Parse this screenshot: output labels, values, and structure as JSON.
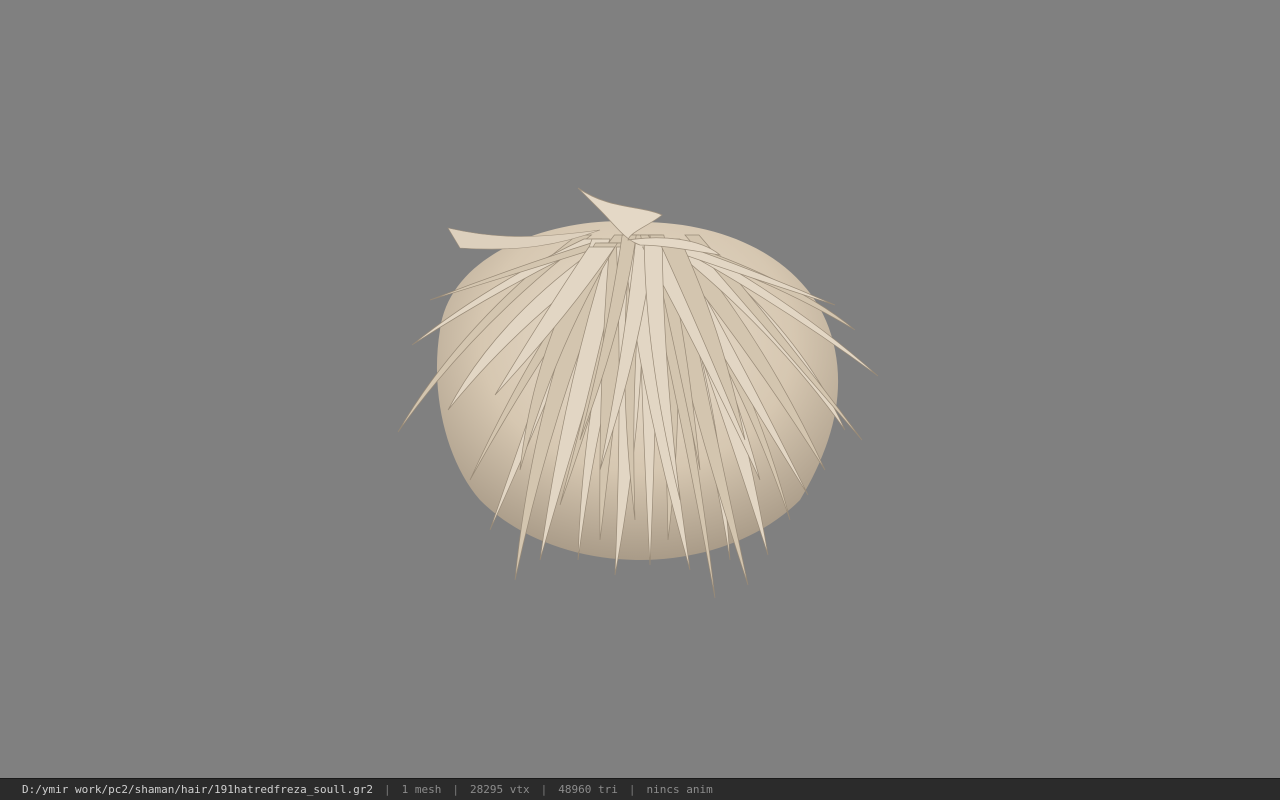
{
  "viewport": {
    "background_color": "#808080",
    "model": {
      "name": "hair-mesh",
      "color": "#d9cbb6"
    }
  },
  "statusbar": {
    "file_path": "D:/ymir work/pc2/shaman/hair/191hatredfreza_soull.gr2",
    "separator": "|",
    "mesh_count": "1 mesh",
    "vertex_count": "28295 vtx",
    "triangle_count": "48960 tri",
    "anim_info": "nincs anim"
  }
}
